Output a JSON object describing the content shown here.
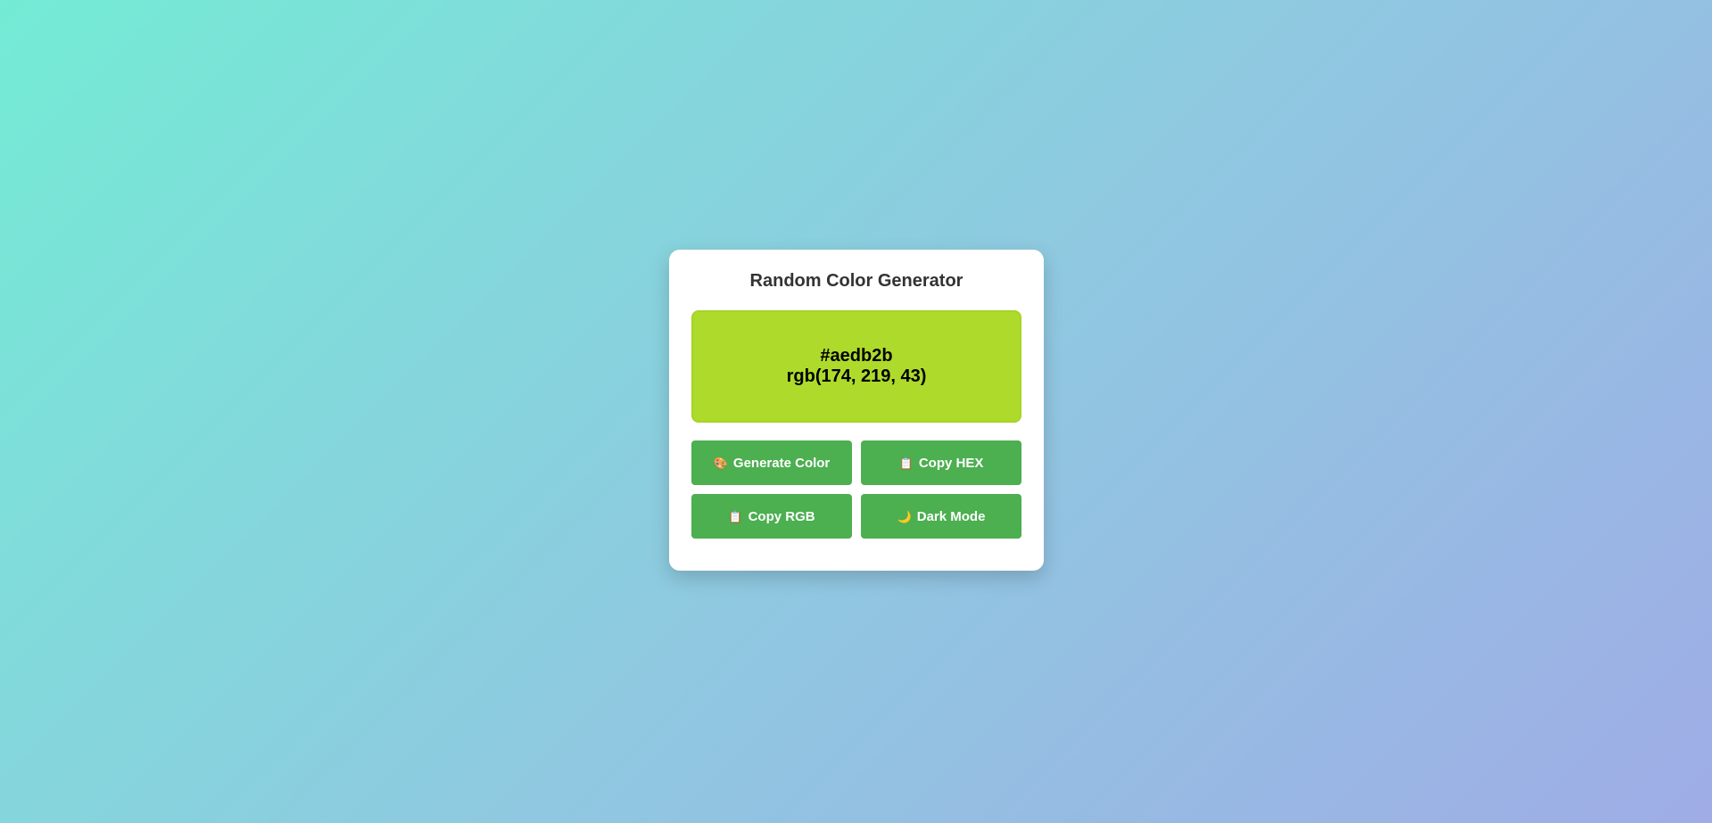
{
  "app": {
    "title": "Random Color Generator"
  },
  "color": {
    "hex": "#aedb2b",
    "rgb": "rgb(174, 219, 43)",
    "swatch_border": "#a6d327"
  },
  "theme": {
    "button_color": "#4caf50",
    "background_gradient": [
      "#74ebd5",
      "#8ecae0",
      "#9face6"
    ]
  },
  "buttons": [
    {
      "label": "Generate Color",
      "icon": "palette-icon",
      "glyph": "🎨"
    },
    {
      "label": "Copy HEX",
      "icon": "clipboard-icon",
      "glyph": "📋"
    },
    {
      "label": "Copy RGB",
      "icon": "clipboard-icon",
      "glyph": "📋"
    },
    {
      "label": "Dark Mode",
      "icon": "moon-icon",
      "glyph": "🌙"
    }
  ]
}
